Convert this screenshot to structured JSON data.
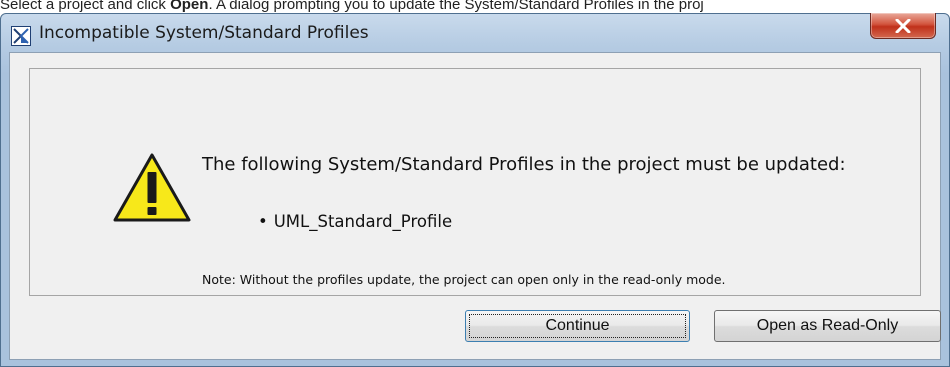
{
  "caption": {
    "prefix": "Select a project and click ",
    "bold": "Open",
    "suffix": ". A dialog prompting you to update the System/Standard Profiles in the proj"
  },
  "window": {
    "title": "Incompatible System/Standard Profiles",
    "close_icon": "close-x-icon",
    "app_icon": "magicdraw-app-icon"
  },
  "message": {
    "icon": "warning-triangle-icon",
    "heading": "The following System/Standard Profiles in the project must be updated:",
    "profiles": [
      "UML_Standard_Profile"
    ],
    "bullet": "•",
    "note": "Note: Without the profiles update, the project can open only in the read-only mode."
  },
  "buttons": {
    "continue_label": "Continue",
    "readonly_label": "Open as Read-Only"
  },
  "colors": {
    "title_bar": "#b6cce3",
    "close_button": "#c0311b",
    "client_background": "#f0f0f0",
    "warning_fill": "#f7e81a",
    "focus_border": "#3c7fb1"
  }
}
